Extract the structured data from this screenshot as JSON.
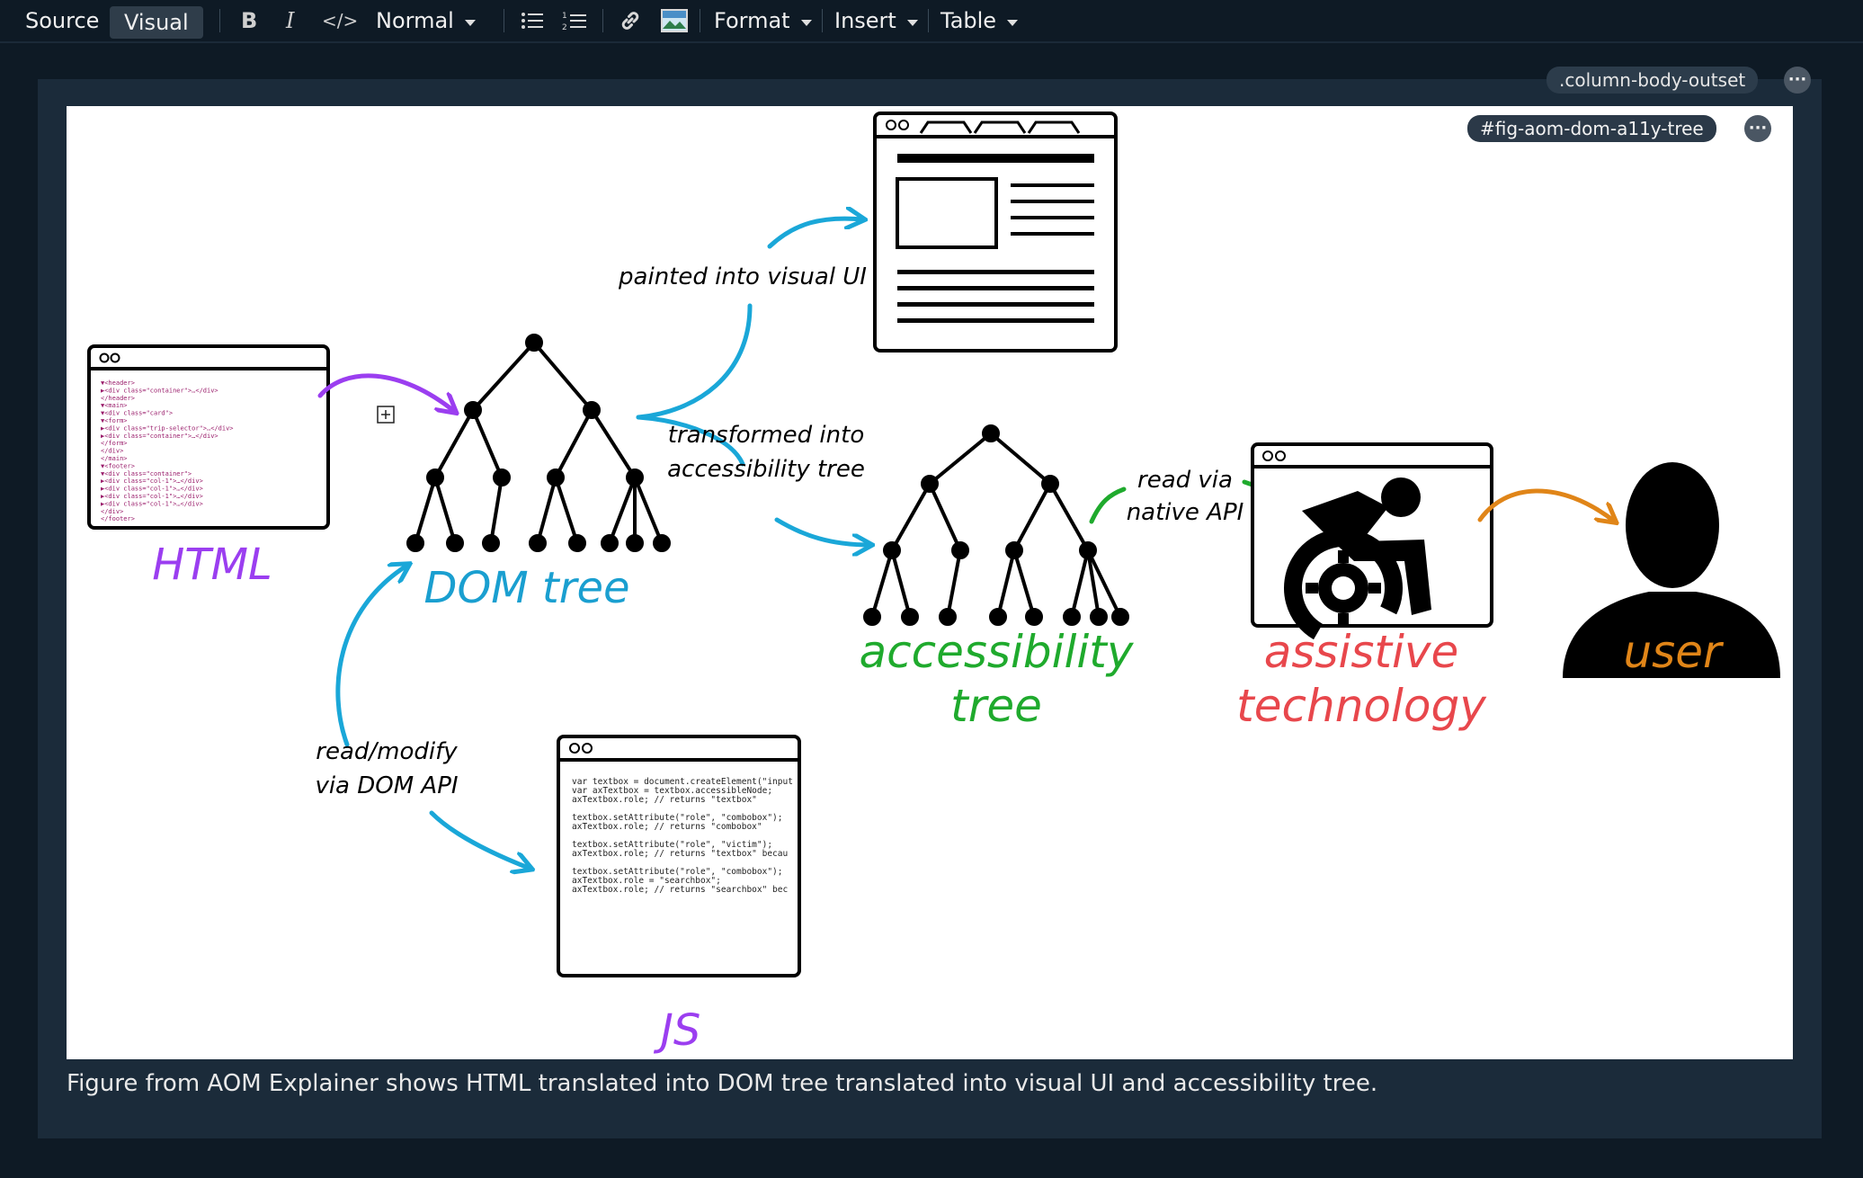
{
  "toolbar": {
    "source_label": "Source",
    "visual_label": "Visual",
    "bold_label": "B",
    "italic_label": "I",
    "code_label": "</>",
    "style_label": "Normal",
    "format_label": "Format",
    "insert_label": "Insert",
    "table_label": "Table"
  },
  "panel": {
    "class_label": ".column-body-outset",
    "figure_id": "#fig-aom-dom-a11y-tree",
    "caption": "Figure from AOM Explainer shows HTML translated into DOM tree translated into visual UI and accessibility tree."
  },
  "figure": {
    "html_label": "HTML",
    "dom_label": "DOM tree",
    "a11y_label_1": "accessibility",
    "a11y_label_2": "tree",
    "at_label_1": "assistive",
    "at_label_2": "technology",
    "user_label": "user",
    "js_label": "JS",
    "arrow_painted": "painted into visual UI",
    "arrow_transformed_1": "transformed into",
    "arrow_transformed_2": "accessibility tree",
    "arrow_read_1": "read via",
    "arrow_read_2": "native API",
    "arrow_modify_1": "read/modify",
    "arrow_modify_2": "via DOM API",
    "html_code": [
      "▼<header>",
      "  ▶<div class=\"container\">…</div>",
      "  </header>",
      "▼<main>",
      "  ▼<div class=\"card\">",
      "    ▼<form>",
      "      ▶<div class=\"trip-selector\">…</div>",
      "      ▶<div class=\"container\">…</div>",
      "    </form>",
      "  </div>",
      "  </main>",
      "▼<footer>",
      "  ▼<div class=\"container\">",
      "    ▶<div class=\"col-1\">…</div>",
      "    ▶<div class=\"col-1\">…</div>",
      "    ▶<div class=\"col-1\">…</div>",
      "    ▶<div class=\"col-1\">…</div>",
      "  </div>",
      "  </footer>"
    ],
    "js_code": [
      "var textbox = document.createElement(\"input",
      "var axTextbox = textbox.accessibleNode;",
      "axTextbox.role;  // returns \"textbox\"",
      "",
      "textbox.setAttribute(\"role\", \"combobox\");",
      "axTextbox.role;  // returns \"combobox\"",
      "",
      "textbox.setAttribute(\"role\", \"victim\");",
      "axTextbox.role;  // returns \"textbox\" becau",
      "",
      "textbox.setAttribute(\"role\", \"combobox\");",
      "axTextbox.role = \"searchbox\";",
      "axTextbox.role;  // returns \"searchbox\" bec"
    ]
  },
  "colors": {
    "html": "#9b3ef0",
    "dom": "#1a9fd0",
    "a11y": "#1faa2d",
    "at": "#e8474c",
    "user": "#e08518",
    "arrow_blue": "#1aa7d8",
    "arrow_green": "#1faa2d",
    "arrow_purple": "#9b3ef0",
    "arrow_orange": "#e08518"
  }
}
